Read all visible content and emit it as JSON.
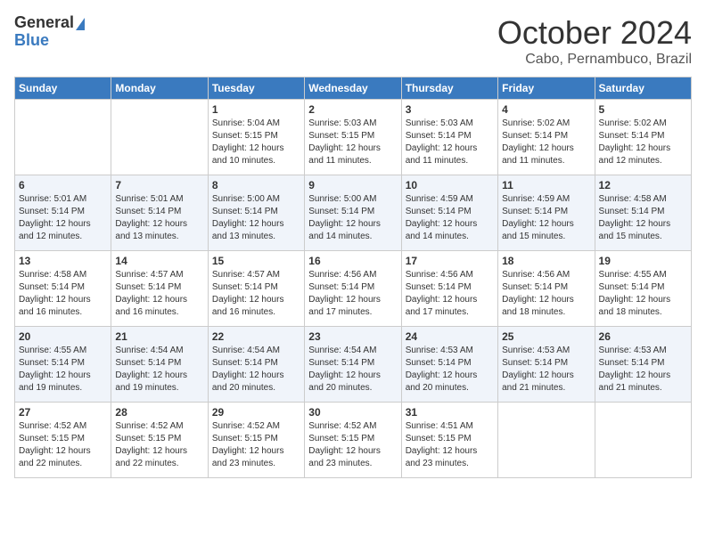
{
  "logo": {
    "general": "General",
    "blue": "Blue"
  },
  "title": {
    "month": "October 2024",
    "location": "Cabo, Pernambuco, Brazil"
  },
  "days_header": [
    "Sunday",
    "Monday",
    "Tuesday",
    "Wednesday",
    "Thursday",
    "Friday",
    "Saturday"
  ],
  "weeks": [
    [
      {
        "day": "",
        "info": ""
      },
      {
        "day": "",
        "info": ""
      },
      {
        "day": "1",
        "info": "Sunrise: 5:04 AM\nSunset: 5:15 PM\nDaylight: 12 hours\nand 10 minutes."
      },
      {
        "day": "2",
        "info": "Sunrise: 5:03 AM\nSunset: 5:15 PM\nDaylight: 12 hours\nand 11 minutes."
      },
      {
        "day": "3",
        "info": "Sunrise: 5:03 AM\nSunset: 5:14 PM\nDaylight: 12 hours\nand 11 minutes."
      },
      {
        "day": "4",
        "info": "Sunrise: 5:02 AM\nSunset: 5:14 PM\nDaylight: 12 hours\nand 11 minutes."
      },
      {
        "day": "5",
        "info": "Sunrise: 5:02 AM\nSunset: 5:14 PM\nDaylight: 12 hours\nand 12 minutes."
      }
    ],
    [
      {
        "day": "6",
        "info": "Sunrise: 5:01 AM\nSunset: 5:14 PM\nDaylight: 12 hours\nand 12 minutes."
      },
      {
        "day": "7",
        "info": "Sunrise: 5:01 AM\nSunset: 5:14 PM\nDaylight: 12 hours\nand 13 minutes."
      },
      {
        "day": "8",
        "info": "Sunrise: 5:00 AM\nSunset: 5:14 PM\nDaylight: 12 hours\nand 13 minutes."
      },
      {
        "day": "9",
        "info": "Sunrise: 5:00 AM\nSunset: 5:14 PM\nDaylight: 12 hours\nand 14 minutes."
      },
      {
        "day": "10",
        "info": "Sunrise: 4:59 AM\nSunset: 5:14 PM\nDaylight: 12 hours\nand 14 minutes."
      },
      {
        "day": "11",
        "info": "Sunrise: 4:59 AM\nSunset: 5:14 PM\nDaylight: 12 hours\nand 15 minutes."
      },
      {
        "day": "12",
        "info": "Sunrise: 4:58 AM\nSunset: 5:14 PM\nDaylight: 12 hours\nand 15 minutes."
      }
    ],
    [
      {
        "day": "13",
        "info": "Sunrise: 4:58 AM\nSunset: 5:14 PM\nDaylight: 12 hours\nand 16 minutes."
      },
      {
        "day": "14",
        "info": "Sunrise: 4:57 AM\nSunset: 5:14 PM\nDaylight: 12 hours\nand 16 minutes."
      },
      {
        "day": "15",
        "info": "Sunrise: 4:57 AM\nSunset: 5:14 PM\nDaylight: 12 hours\nand 16 minutes."
      },
      {
        "day": "16",
        "info": "Sunrise: 4:56 AM\nSunset: 5:14 PM\nDaylight: 12 hours\nand 17 minutes."
      },
      {
        "day": "17",
        "info": "Sunrise: 4:56 AM\nSunset: 5:14 PM\nDaylight: 12 hours\nand 17 minutes."
      },
      {
        "day": "18",
        "info": "Sunrise: 4:56 AM\nSunset: 5:14 PM\nDaylight: 12 hours\nand 18 minutes."
      },
      {
        "day": "19",
        "info": "Sunrise: 4:55 AM\nSunset: 5:14 PM\nDaylight: 12 hours\nand 18 minutes."
      }
    ],
    [
      {
        "day": "20",
        "info": "Sunrise: 4:55 AM\nSunset: 5:14 PM\nDaylight: 12 hours\nand 19 minutes."
      },
      {
        "day": "21",
        "info": "Sunrise: 4:54 AM\nSunset: 5:14 PM\nDaylight: 12 hours\nand 19 minutes."
      },
      {
        "day": "22",
        "info": "Sunrise: 4:54 AM\nSunset: 5:14 PM\nDaylight: 12 hours\nand 20 minutes."
      },
      {
        "day": "23",
        "info": "Sunrise: 4:54 AM\nSunset: 5:14 PM\nDaylight: 12 hours\nand 20 minutes."
      },
      {
        "day": "24",
        "info": "Sunrise: 4:53 AM\nSunset: 5:14 PM\nDaylight: 12 hours\nand 20 minutes."
      },
      {
        "day": "25",
        "info": "Sunrise: 4:53 AM\nSunset: 5:14 PM\nDaylight: 12 hours\nand 21 minutes."
      },
      {
        "day": "26",
        "info": "Sunrise: 4:53 AM\nSunset: 5:14 PM\nDaylight: 12 hours\nand 21 minutes."
      }
    ],
    [
      {
        "day": "27",
        "info": "Sunrise: 4:52 AM\nSunset: 5:15 PM\nDaylight: 12 hours\nand 22 minutes."
      },
      {
        "day": "28",
        "info": "Sunrise: 4:52 AM\nSunset: 5:15 PM\nDaylight: 12 hours\nand 22 minutes."
      },
      {
        "day": "29",
        "info": "Sunrise: 4:52 AM\nSunset: 5:15 PM\nDaylight: 12 hours\nand 23 minutes."
      },
      {
        "day": "30",
        "info": "Sunrise: 4:52 AM\nSunset: 5:15 PM\nDaylight: 12 hours\nand 23 minutes."
      },
      {
        "day": "31",
        "info": "Sunrise: 4:51 AM\nSunset: 5:15 PM\nDaylight: 12 hours\nand 23 minutes."
      },
      {
        "day": "",
        "info": ""
      },
      {
        "day": "",
        "info": ""
      }
    ]
  ]
}
